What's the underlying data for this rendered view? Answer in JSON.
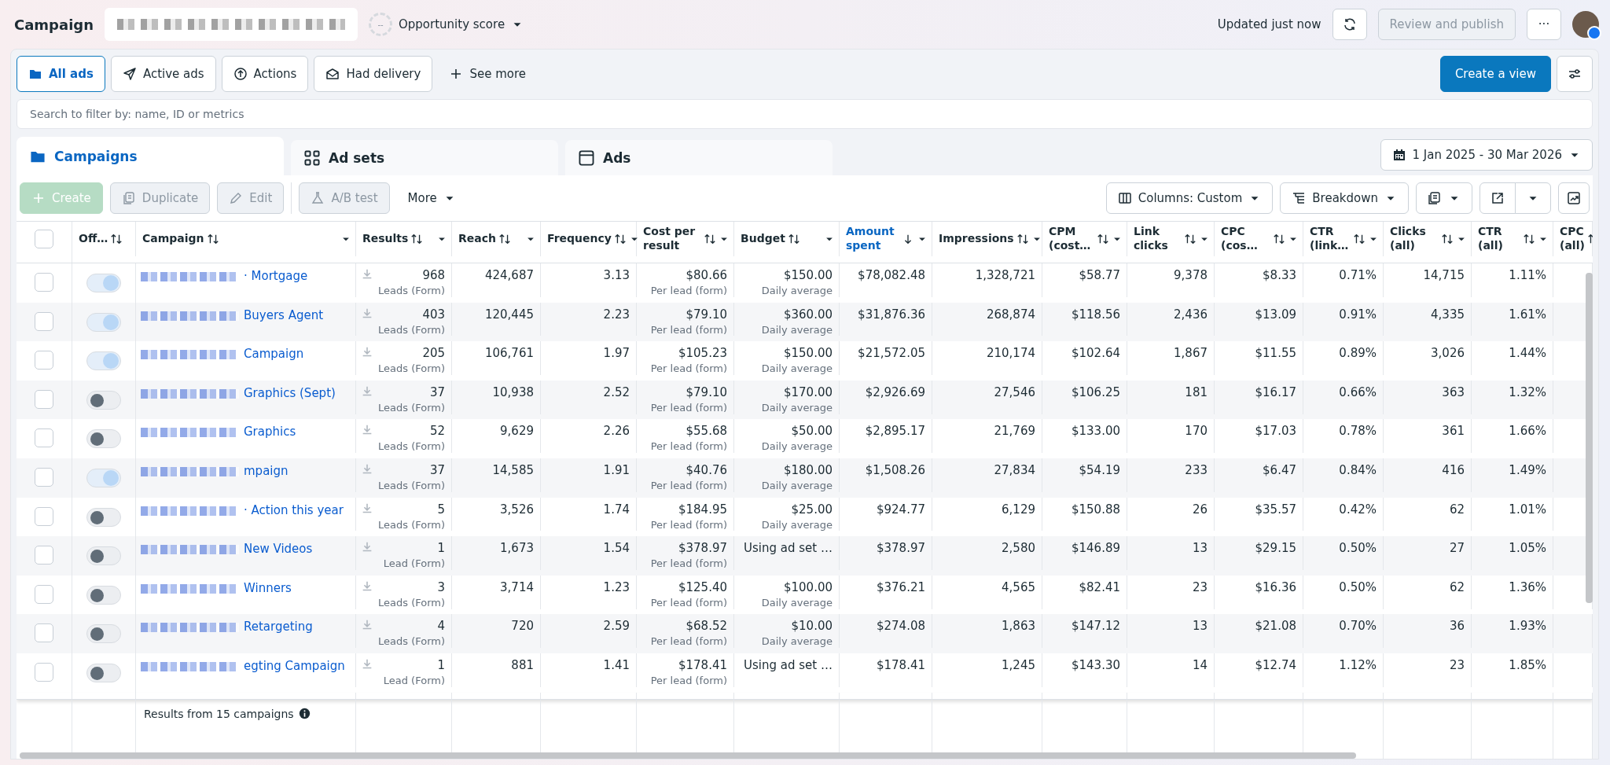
{
  "header": {
    "title": "Campaign",
    "opportunity": {
      "gauge": "--",
      "label": "Opportunity score"
    },
    "updated": "Updated just now",
    "review_button": {
      "label": "Review and publish",
      "disabled": true
    },
    "more_button": "···"
  },
  "filters": [
    {
      "label": "All ads",
      "selected": true
    },
    {
      "label": "Active ads",
      "selected": false
    },
    {
      "label": "Actions",
      "selected": false
    },
    {
      "label": "Had delivery",
      "selected": false
    }
  ],
  "see_more": "See more",
  "create_view": "Create a view",
  "search": {
    "placeholder": "Search to filter by: name, ID or metrics"
  },
  "level_tabs": [
    {
      "label": "Campaigns",
      "selected": true
    },
    {
      "label": "Ad sets",
      "selected": false
    },
    {
      "label": "Ads",
      "selected": false
    }
  ],
  "date_range": "1 Jan 2025 - 30 Mar 2026",
  "actions": [
    {
      "label": "Create",
      "kind": "primary",
      "disabled": true
    },
    {
      "label": "Duplicate",
      "kind": "plain",
      "disabled": true
    },
    {
      "label": "Edit",
      "kind": "plain",
      "disabled": true
    },
    {
      "label": "A/B test",
      "kind": "plain",
      "disabled": true
    },
    {
      "label": "More",
      "kind": "menu",
      "disabled": false
    }
  ],
  "view_tools": [
    {
      "label": "Columns: Custom"
    },
    {
      "label": "Breakdown"
    }
  ],
  "table": {
    "header_checkbox": {
      "checked": false
    },
    "columns": [
      {
        "label": "Off…",
        "sorted": false
      },
      {
        "label": "Campaign",
        "sorted": false
      },
      {
        "label": "Results",
        "sorted": false
      },
      {
        "label": "Reach",
        "sorted": false
      },
      {
        "label": "Frequency",
        "sorted": false
      },
      {
        "label": "Cost per result",
        "sorted": false
      },
      {
        "label": "Budget",
        "sorted": false
      },
      {
        "label": "Amount spent",
        "sorted": true
      },
      {
        "label": "Impressions",
        "sorted": false
      },
      {
        "label": "CPM (cost…",
        "sorted": false
      },
      {
        "label": "Link clicks",
        "sorted": false
      },
      {
        "label": "CPC (cos…",
        "sorted": false
      },
      {
        "label": "CTR (link…",
        "sorted": false
      },
      {
        "label": "Clicks (all)",
        "sorted": false
      },
      {
        "label": "CTR (all)",
        "sorted": false
      },
      {
        "label": "CPC (all)",
        "sorted": false
      }
    ],
    "rows": [
      {
        "checked": false,
        "on": true,
        "name": "· Mortgage",
        "values": [
          {
            "text": "968",
            "sub": "Leads (Form)"
          },
          {
            "text": "424,687"
          },
          {
            "text": "3.13"
          },
          {
            "text": "$80.66",
            "sub": "Per lead (form)"
          },
          {
            "text": "$150.00",
            "sub": "Daily average"
          },
          {
            "text": "$78,082.48"
          },
          {
            "text": "1,328,721"
          },
          {
            "text": "$58.77"
          },
          {
            "text": "9,378"
          },
          {
            "text": "$8.33"
          },
          {
            "text": "0.71%"
          },
          {
            "text": "14,715"
          },
          {
            "text": "1.11%"
          }
        ]
      },
      {
        "checked": false,
        "on": true,
        "name": "Buyers Agent",
        "values": [
          {
            "text": "403",
            "sub": "Leads (Form)"
          },
          {
            "text": "120,445"
          },
          {
            "text": "2.23"
          },
          {
            "text": "$79.10",
            "sub": "Per lead (form)"
          },
          {
            "text": "$360.00",
            "sub": "Daily average"
          },
          {
            "text": "$31,876.36"
          },
          {
            "text": "268,874"
          },
          {
            "text": "$118.56"
          },
          {
            "text": "2,436"
          },
          {
            "text": "$13.09"
          },
          {
            "text": "0.91%"
          },
          {
            "text": "4,335"
          },
          {
            "text": "1.61%"
          }
        ]
      },
      {
        "checked": false,
        "on": true,
        "name": "Campaign",
        "values": [
          {
            "text": "205",
            "sub": "Leads (Form)"
          },
          {
            "text": "106,761"
          },
          {
            "text": "1.97"
          },
          {
            "text": "$105.23",
            "sub": "Per lead (form)"
          },
          {
            "text": "$150.00",
            "sub": "Daily average"
          },
          {
            "text": "$21,572.05"
          },
          {
            "text": "210,174"
          },
          {
            "text": "$102.64"
          },
          {
            "text": "1,867"
          },
          {
            "text": "$11.55"
          },
          {
            "text": "0.89%"
          },
          {
            "text": "3,026"
          },
          {
            "text": "1.44%"
          }
        ]
      },
      {
        "checked": false,
        "on": false,
        "name": "Graphics (Sept)",
        "values": [
          {
            "text": "37",
            "sub": "Leads (Form)"
          },
          {
            "text": "10,938"
          },
          {
            "text": "2.52"
          },
          {
            "text": "$79.10",
            "sub": "Per lead (form)"
          },
          {
            "text": "$170.00",
            "sub": "Daily average"
          },
          {
            "text": "$2,926.69"
          },
          {
            "text": "27,546"
          },
          {
            "text": "$106.25"
          },
          {
            "text": "181"
          },
          {
            "text": "$16.17"
          },
          {
            "text": "0.66%"
          },
          {
            "text": "363"
          },
          {
            "text": "1.32%"
          }
        ]
      },
      {
        "checked": false,
        "on": false,
        "name": "Graphics",
        "values": [
          {
            "text": "52",
            "sub": "Leads (Form)"
          },
          {
            "text": "9,629"
          },
          {
            "text": "2.26"
          },
          {
            "text": "$55.68",
            "sub": "Per lead (form)"
          },
          {
            "text": "$50.00",
            "sub": "Daily average"
          },
          {
            "text": "$2,895.17"
          },
          {
            "text": "21,769"
          },
          {
            "text": "$133.00"
          },
          {
            "text": "170"
          },
          {
            "text": "$17.03"
          },
          {
            "text": "0.78%"
          },
          {
            "text": "361"
          },
          {
            "text": "1.66%"
          }
        ]
      },
      {
        "checked": false,
        "on": true,
        "name": "mpaign",
        "values": [
          {
            "text": "37",
            "sub": "Leads (Form)"
          },
          {
            "text": "14,585"
          },
          {
            "text": "1.91"
          },
          {
            "text": "$40.76",
            "sub": "Per lead (form)"
          },
          {
            "text": "$180.00",
            "sub": "Daily average"
          },
          {
            "text": "$1,508.26"
          },
          {
            "text": "27,834"
          },
          {
            "text": "$54.19"
          },
          {
            "text": "233"
          },
          {
            "text": "$6.47"
          },
          {
            "text": "0.84%"
          },
          {
            "text": "416"
          },
          {
            "text": "1.49%"
          }
        ]
      },
      {
        "checked": false,
        "on": false,
        "name": "· Action this year",
        "values": [
          {
            "text": "5",
            "sub": "Leads (Form)"
          },
          {
            "text": "3,526"
          },
          {
            "text": "1.74"
          },
          {
            "text": "$184.95",
            "sub": "Per lead (form)"
          },
          {
            "text": "$25.00",
            "sub": "Daily average"
          },
          {
            "text": "$924.77"
          },
          {
            "text": "6,129"
          },
          {
            "text": "$150.88"
          },
          {
            "text": "26"
          },
          {
            "text": "$35.57"
          },
          {
            "text": "0.42%"
          },
          {
            "text": "62"
          },
          {
            "text": "1.01%"
          }
        ]
      },
      {
        "checked": false,
        "on": false,
        "name": "New Videos",
        "values": [
          {
            "text": "1",
            "sub": "Lead (Form)"
          },
          {
            "text": "1,673"
          },
          {
            "text": "1.54"
          },
          {
            "text": "$378.97",
            "sub": "Per lead (form)"
          },
          {
            "text": "Using ad set …"
          },
          {
            "text": "$378.97"
          },
          {
            "text": "2,580"
          },
          {
            "text": "$146.89"
          },
          {
            "text": "13"
          },
          {
            "text": "$29.15"
          },
          {
            "text": "0.50%"
          },
          {
            "text": "27"
          },
          {
            "text": "1.05%"
          }
        ]
      },
      {
        "checked": false,
        "on": false,
        "name": "Winners",
        "values": [
          {
            "text": "3",
            "sub": "Leads (Form)"
          },
          {
            "text": "3,714"
          },
          {
            "text": "1.23"
          },
          {
            "text": "$125.40",
            "sub": "Per lead (form)"
          },
          {
            "text": "$100.00",
            "sub": "Daily average"
          },
          {
            "text": "$376.21"
          },
          {
            "text": "4,565"
          },
          {
            "text": "$82.41"
          },
          {
            "text": "23"
          },
          {
            "text": "$16.36"
          },
          {
            "text": "0.50%"
          },
          {
            "text": "62"
          },
          {
            "text": "1.36%"
          }
        ]
      },
      {
        "checked": false,
        "on": false,
        "name": "Retargeting",
        "values": [
          {
            "text": "4",
            "sub": "Leads (Form)"
          },
          {
            "text": "720"
          },
          {
            "text": "2.59"
          },
          {
            "text": "$68.52",
            "sub": "Per lead (form)"
          },
          {
            "text": "$10.00",
            "sub": "Daily average"
          },
          {
            "text": "$274.08"
          },
          {
            "text": "1,863"
          },
          {
            "text": "$147.12"
          },
          {
            "text": "13"
          },
          {
            "text": "$21.08"
          },
          {
            "text": "0.70%"
          },
          {
            "text": "36"
          },
          {
            "text": "1.93%"
          }
        ]
      },
      {
        "checked": false,
        "on": false,
        "name": "egting Campaign",
        "values": [
          {
            "text": "1",
            "sub": "Lead (Form)"
          },
          {
            "text": "881"
          },
          {
            "text": "1.41"
          },
          {
            "text": "$178.41",
            "sub": "Per lead (form)"
          },
          {
            "text": "Using ad set …"
          },
          {
            "text": "$178.41"
          },
          {
            "text": "1,245"
          },
          {
            "text": "$143.30"
          },
          {
            "text": "14"
          },
          {
            "text": "$12.74"
          },
          {
            "text": "1.12%"
          },
          {
            "text": "23"
          },
          {
            "text": "1.85%"
          }
        ]
      }
    ],
    "footer": "Results from 15 campaigns"
  }
}
